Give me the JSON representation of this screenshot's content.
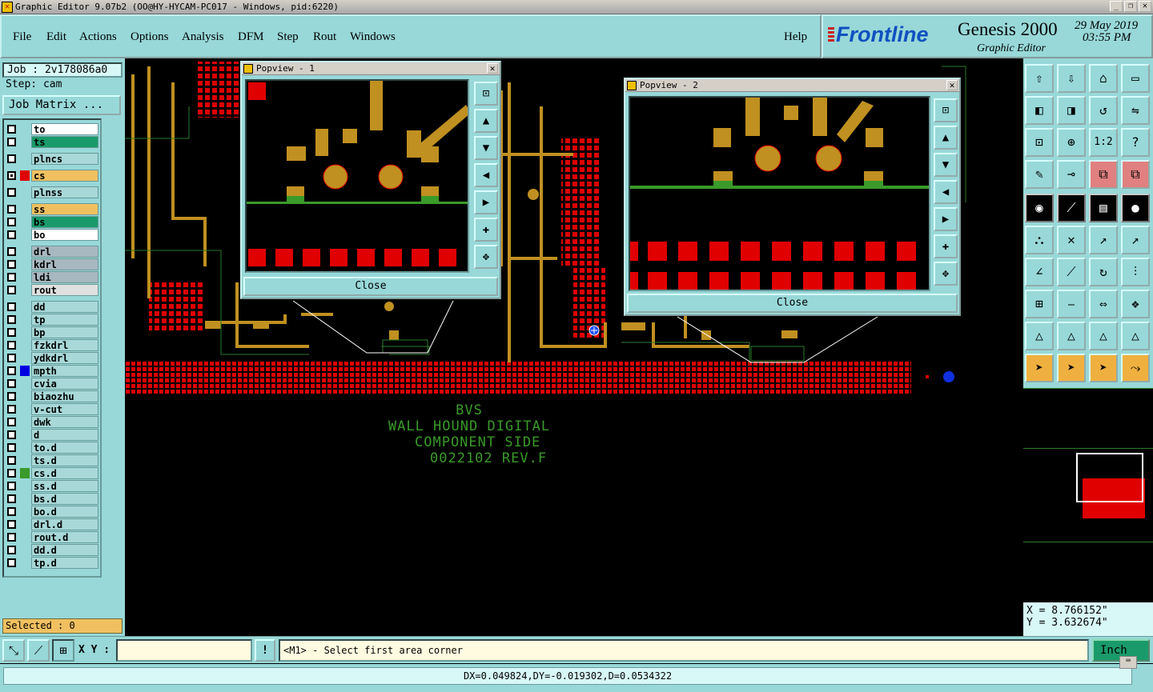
{
  "window": {
    "title": "Graphic Editor 9.07b2 (OO@HY-HYCAM-PC017 - Windows, pid:6220)"
  },
  "menu": {
    "items": [
      "File",
      "Edit",
      "Actions",
      "Options",
      "Analysis",
      "DFM",
      "Step",
      "Rout",
      "Windows"
    ],
    "help": "Help"
  },
  "brand": {
    "logo": "Frontline",
    "product": "Genesis 2000",
    "subtitle": "Graphic Editor",
    "date": "29 May 2019",
    "time": "03:55 PM"
  },
  "job": {
    "job_label": "Job : 2v178086a0",
    "step_label": "Step: cam",
    "matrix_button": "Job Matrix ..."
  },
  "layers": [
    {
      "name": "to",
      "bg": "#ffffff",
      "checked": false,
      "swatch": ""
    },
    {
      "name": "ts",
      "bg": "#1a9a6a",
      "checked": false,
      "swatch": ""
    },
    {
      "name": "plncs",
      "bg": "#a8d8d8",
      "checked": false,
      "swatch": ""
    },
    {
      "name": "cs",
      "bg": "#f0c060",
      "checked": true,
      "swatch": "#e00000"
    },
    {
      "name": "plnss",
      "bg": "#a8d8d8",
      "checked": false,
      "swatch": ""
    },
    {
      "name": "ss",
      "bg": "#f0c060",
      "checked": false,
      "swatch": ""
    },
    {
      "name": "bs",
      "bg": "#1a9a6a",
      "checked": false,
      "swatch": ""
    },
    {
      "name": "bo",
      "bg": "#ffffff",
      "checked": false,
      "swatch": ""
    },
    {
      "name": "drl",
      "bg": "#a8b8c0",
      "checked": false,
      "swatch": ""
    },
    {
      "name": "kdrl",
      "bg": "#a8b8c0",
      "checked": false,
      "swatch": ""
    },
    {
      "name": "ldi",
      "bg": "#a8b8c0",
      "checked": false,
      "swatch": ""
    },
    {
      "name": "rout",
      "bg": "#e0e0e0",
      "checked": false,
      "swatch": ""
    },
    {
      "name": "dd",
      "bg": "#a8d8d8",
      "checked": false,
      "swatch": ""
    },
    {
      "name": "tp",
      "bg": "#a8d8d8",
      "checked": false,
      "swatch": ""
    },
    {
      "name": "bp",
      "bg": "#a8d8d8",
      "checked": false,
      "swatch": ""
    },
    {
      "name": "fzkdrl",
      "bg": "#a8d8d8",
      "checked": false,
      "swatch": ""
    },
    {
      "name": "ydkdrl",
      "bg": "#a8d8d8",
      "checked": false,
      "swatch": ""
    },
    {
      "name": "mpth",
      "bg": "#a8d8d8",
      "checked": false,
      "swatch": "#0000e0"
    },
    {
      "name": "cvia",
      "bg": "#a8d8d8",
      "checked": false,
      "swatch": ""
    },
    {
      "name": "biaozhu",
      "bg": "#a8d8d8",
      "checked": false,
      "swatch": ""
    },
    {
      "name": "v-cut",
      "bg": "#a8d8d8",
      "checked": false,
      "swatch": ""
    },
    {
      "name": "dwk",
      "bg": "#a8d8d8",
      "checked": false,
      "swatch": ""
    },
    {
      "name": "d",
      "bg": "#a8d8d8",
      "checked": false,
      "swatch": ""
    },
    {
      "name": "to.d",
      "bg": "#a8d8d8",
      "checked": false,
      "swatch": ""
    },
    {
      "name": "ts.d",
      "bg": "#a8d8d8",
      "checked": false,
      "swatch": ""
    },
    {
      "name": "cs.d",
      "bg": "#a8d8d8",
      "checked": false,
      "swatch": "#3a9a2a"
    },
    {
      "name": "ss.d",
      "bg": "#a8d8d8",
      "checked": false,
      "swatch": ""
    },
    {
      "name": "bs.d",
      "bg": "#a8d8d8",
      "checked": false,
      "swatch": ""
    },
    {
      "name": "bo.d",
      "bg": "#a8d8d8",
      "checked": false,
      "swatch": ""
    },
    {
      "name": "drl.d",
      "bg": "#a8d8d8",
      "checked": false,
      "swatch": ""
    },
    {
      "name": "rout.d",
      "bg": "#a8d8d8",
      "checked": false,
      "swatch": ""
    },
    {
      "name": "dd.d",
      "bg": "#a8d8d8",
      "checked": false,
      "swatch": ""
    },
    {
      "name": "tp.d",
      "bg": "#a8d8d8",
      "checked": false,
      "swatch": ""
    }
  ],
  "selected": "Selected : 0",
  "silkscreen": {
    "line1": "BVS",
    "line2": "WALL HOUND DIGITAL",
    "line3": "COMPONENT SIDE",
    "line4": "0022102 REV.F"
  },
  "popview1": {
    "title": "Popview - 1",
    "close": "Close"
  },
  "popview2": {
    "title": "Popview - 2",
    "close": "Close"
  },
  "coords": {
    "x": "X = 8.766152\"",
    "y": "Y = 3.632674\""
  },
  "bottom": {
    "xy_label": "X Y :",
    "xy_value": "",
    "prompt": "<M1> - Select first area corner",
    "units": "Inch"
  },
  "status": {
    "delta": "DX=0.049824,DY=-0.019302,D=0.0534322"
  },
  "colors": {
    "panel": "#98d8d8",
    "copper": "#c09020",
    "pad": "#e00000",
    "green": "#3a9a2a"
  }
}
